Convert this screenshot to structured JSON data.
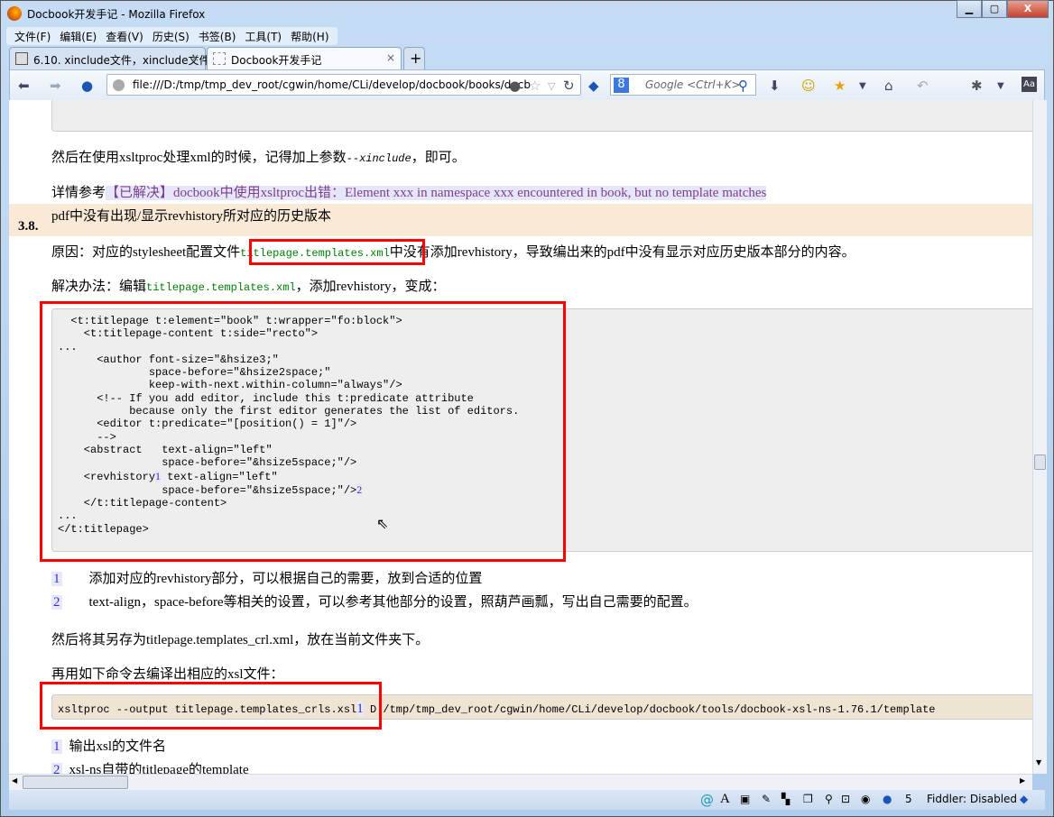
{
  "window": {
    "title": "Docbook开发手记 - Mozilla Firefox",
    "minimize": "▁",
    "maximize": "▢",
    "close": "X"
  },
  "menu": [
    "文件(F)",
    "编辑(E)",
    "查看(V)",
    "历史(S)",
    "书签(B)",
    "工具(T)",
    "帮助(H)"
  ],
  "tabs": [
    {
      "label": "6.10. xinclude文件，xinclude文件中...",
      "active": false
    },
    {
      "label": "Docbook开发手记",
      "active": true
    }
  ],
  "new_tab": "+",
  "nav": {
    "url": "file:///D:/tmp/tmp_dev_root/cgwin/home/CLi/develop/docbook/books/docb",
    "search_placeholder": "Google <Ctrl+K>",
    "search_engine": "8"
  },
  "content": {
    "p1_pre": "然后在使用xsltproc处理xml的时候，记得加上参数",
    "p1_code": "--xinclude",
    "p1_post": "，即可。",
    "p2_pre": "详情参考",
    "p2_link": "【已解决】docbook中使用xsltproc出错：Element xxx in namespace xxx encountered in book, but no template matches",
    "section_num": "3.8.",
    "section_title": "pdf中没有出现/显示revhistory所对应的历史版本",
    "p3_pre": "原因：对应的stylesheet配置文件",
    "p3_code": "titlepage.templates.xml",
    "p3_post": "中没有添加revhistory，导致编出来的pdf中没有显示对应历史版本部分的内容。",
    "p4_pre": "解决办法：编辑",
    "p4_code": "titlepage.templates.xml",
    "p4_post": "，添加revhistory，变成：",
    "code_a": "  <t:titlepage t:element=\"book\" t:wrapper=\"fo:block\">\n    <t:titlepage-content t:side=\"recto\">\n...\n      <author font-size=\"&hsize3;\"\n              space-before=\"&hsize2space;\"\n              keep-with-next.within-column=\"always\"/>\n      <!-- If you add editor, include this t:predicate attribute\n           because only the first editor generates the list of editors.\n      <editor t:predicate=\"[position() = 1]\"/>\n      -->\n    <abstract   text-align=\"left\"\n                space-before=\"&hsize5space;\"/>\n    <revhistory",
    "code_co1": "1",
    "code_b": " text-align=\"left\"\n                space-before=\"&hsize5space;\"/>",
    "code_co2": "2",
    "code_c": "\n    </t:titlepage-content>\n...\n</t:titlepage>",
    "callouts": [
      {
        "num": "1",
        "text": "添加对应的revhistory部分，可以根据自己的需要，放到合适的位置"
      },
      {
        "num": "2",
        "text": "text-align，space-before等相关的设置，可以参考其他部分的设置，照葫芦画瓢，写出自己需要的配置。"
      }
    ],
    "p5": "然后将其另存为titlepage.templates_crl.xml，放在当前文件夹下。",
    "p6": "再用如下命令去编译出相应的xsl文件：",
    "cmd_a": "xsltproc --output titlepage.templates_crls.xsl",
    "cmd_co1": "1",
    "cmd_b": " D:/tmp/tmp_dev_root/cgwin/home/CLi/develop/docbook/tools/docbook-xsl-ns-1.76.1/template",
    "callouts2": [
      {
        "num": "1",
        "text": "输出xsl的文件名"
      },
      {
        "num": "2",
        "text": "xsl-ns自带的titlepage的template"
      }
    ]
  },
  "status": {
    "count": "5",
    "fiddler": "Fiddler: Disabled"
  },
  "colors": {
    "section_bg": "#f9e9d6",
    "code_bg": "#eeeeee",
    "cmd_bg": "#efe3d3",
    "link": "#7b3f8c",
    "highlight": "#ff0000"
  }
}
